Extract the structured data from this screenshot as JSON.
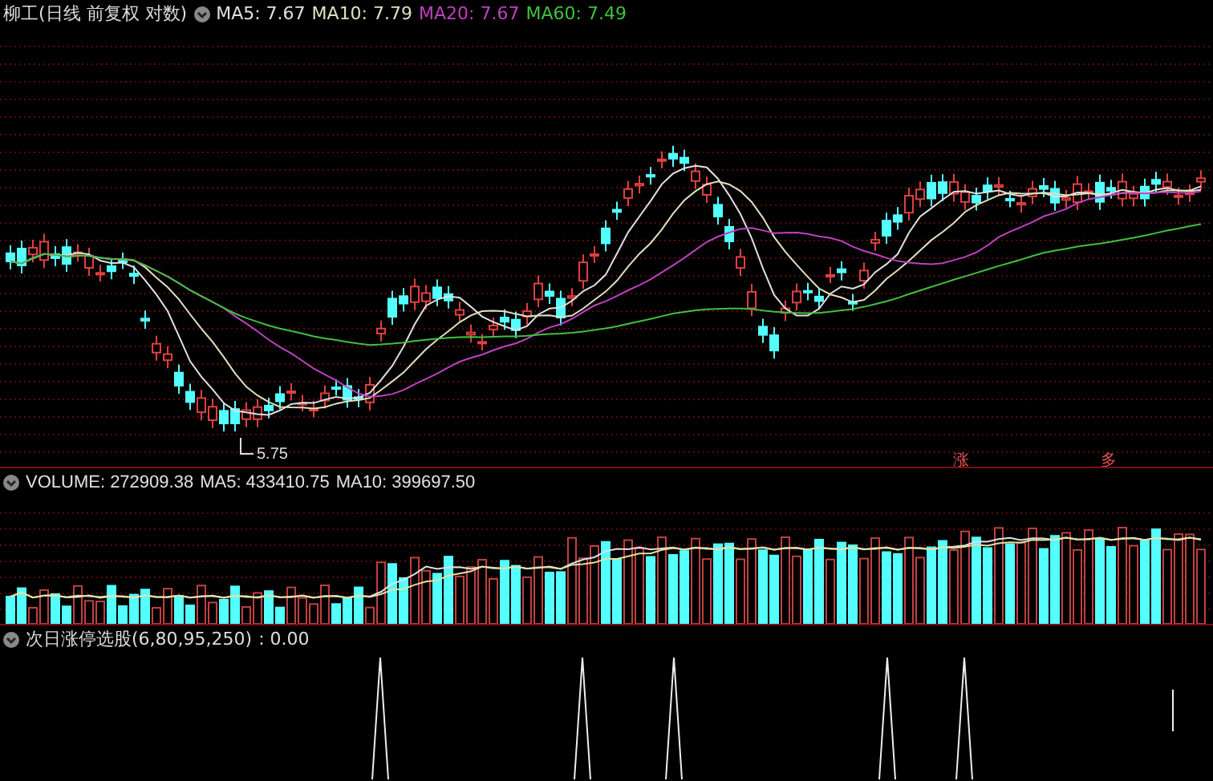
{
  "price_panel": {
    "title": "柳工(日线 前复权 对数)",
    "legend": [
      {
        "label": "MA5: 7.67",
        "color": "#e0e0e0"
      },
      {
        "label": "MA10: 7.79",
        "color": "#e0e0c0"
      },
      {
        "label": "MA20: 7.67",
        "color": "#c040c0"
      },
      {
        "label": "MA60: 7.49",
        "color": "#40c040"
      }
    ],
    "low_label": "5.75",
    "signals": [
      {
        "text": "涨"
      },
      {
        "text": "多"
      }
    ]
  },
  "volume_panel": {
    "legend": [
      {
        "label": "VOLUME: 272909.38",
        "color": "#e0e0e0"
      },
      {
        "label": "MA5: 433410.75",
        "color": "#e0e0e0"
      },
      {
        "label": "MA10: 399697.50",
        "color": "#e0e0e0"
      }
    ]
  },
  "indicator_panel": {
    "name": "次日涨停选股(6,80,95,250)",
    "value": ": 0.00"
  }
}
